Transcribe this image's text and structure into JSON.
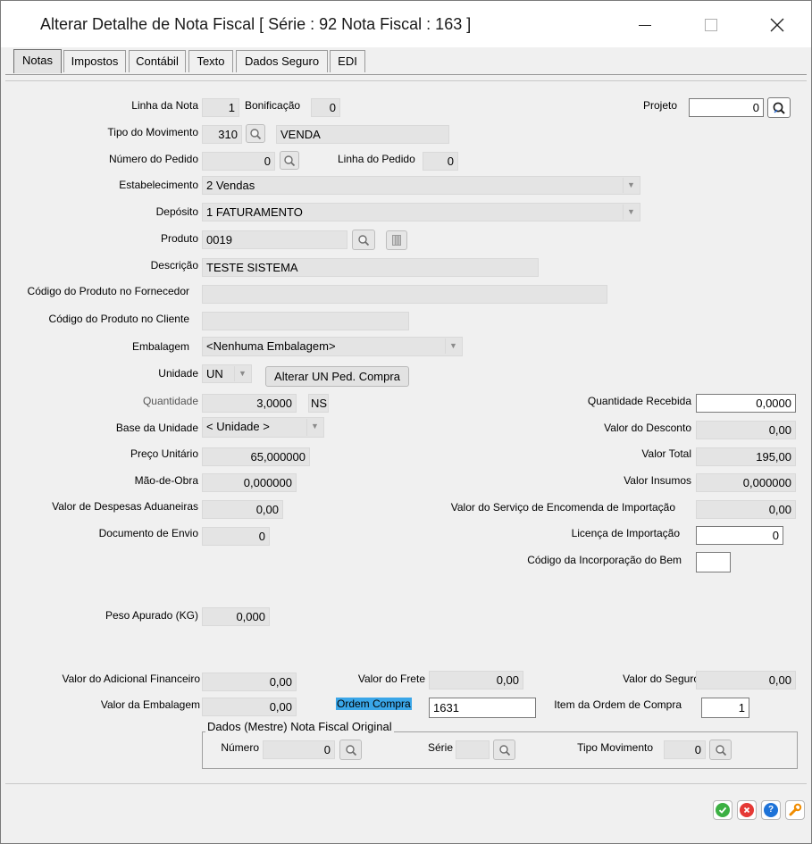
{
  "window": {
    "title": "Alterar Detalhe de Nota Fiscal [ Série : 92 Nota Fiscal : 163 ]"
  },
  "tabs": [
    {
      "label": "Notas",
      "active": true
    },
    {
      "label": "Impostos"
    },
    {
      "label": "Contábil"
    },
    {
      "label": "Texto"
    },
    {
      "label": "Dados Seguro"
    },
    {
      "label": "EDI"
    }
  ],
  "form": {
    "linha_da_nota": {
      "label": "Linha da Nota",
      "value": "1"
    },
    "bonificacao": {
      "label": "Bonificação",
      "value": "0"
    },
    "projeto": {
      "label": "Projeto",
      "value": "0"
    },
    "tipo_movimento": {
      "label": "Tipo do Movimento",
      "code": "310",
      "desc": "VENDA"
    },
    "numero_pedido": {
      "label": "Número do Pedido",
      "value": "0"
    },
    "linha_pedido": {
      "label": "Linha do Pedido",
      "value": "0"
    },
    "estabelecimento": {
      "label": "Estabelecimento",
      "value": "2 Vendas"
    },
    "deposito": {
      "label": "Depósito",
      "value": "1 FATURAMENTO"
    },
    "produto": {
      "label": "Produto",
      "value": "0019"
    },
    "descricao": {
      "label": "Descrição",
      "value": "TESTE SISTEMA"
    },
    "cod_prod_fornecedor": {
      "label": "Código do Produto no Fornecedor",
      "value": ""
    },
    "cod_prod_cliente": {
      "label": "Código do Produto no Cliente",
      "value": ""
    },
    "embalagem": {
      "label": "Embalagem",
      "value": "<Nenhuma Embalagem>"
    },
    "unidade": {
      "label": "Unidade",
      "value": "UN"
    },
    "alterar_un_btn": "Alterar UN Ped. Compra",
    "quantidade": {
      "label": "Quantidade",
      "value": "3,0000",
      "suffix": "NS"
    },
    "quantidade_recebida": {
      "label": "Quantidade Recebida",
      "value": "0,0000"
    },
    "base_unidade": {
      "label": "Base da Unidade",
      "value": "< Unidade >"
    },
    "valor_desconto": {
      "label": "Valor do Desconto",
      "value": "0,00"
    },
    "preco_unitario": {
      "label": "Preço Unitário",
      "value": "65,000000"
    },
    "valor_total": {
      "label": "Valor Total",
      "value": "195,00"
    },
    "mao_de_obra": {
      "label": "Mão-de-Obra",
      "value": "0,000000"
    },
    "valor_insumos": {
      "label": "Valor Insumos",
      "value": "0,000000"
    },
    "despesas_aduaneiras": {
      "label": "Valor de Despesas Aduaneiras",
      "value": "0,00"
    },
    "servico_encomenda": {
      "label": "Valor do Serviço de Encomenda de Importação",
      "value": "0,00"
    },
    "documento_envio": {
      "label": "Documento de Envio",
      "value": "0"
    },
    "licenca_importacao": {
      "label": "Licença de Importação",
      "value": "0"
    },
    "codigo_incorporacao": {
      "label": "Código da Incorporação do Bem",
      "value": ""
    },
    "peso_apurado": {
      "label": "Peso Apurado (KG)",
      "value": "0,000"
    },
    "adicional_financeiro": {
      "label": "Valor do Adicional Financeiro",
      "value": "0,00"
    },
    "valor_frete": {
      "label": "Valor do Frete",
      "value": "0,00"
    },
    "valor_seguro": {
      "label": "Valor do Seguro",
      "value": "0,00"
    },
    "valor_embalagem": {
      "label": "Valor da Embalagem",
      "value": "0,00"
    },
    "ordem_compra": {
      "label": "Ordem Compra",
      "value": "1631"
    },
    "item_ordem_compra": {
      "label": "Item da Ordem de Compra",
      "value": "1"
    }
  },
  "nf_original": {
    "title": "Dados (Mestre) Nota Fiscal Original",
    "numero": {
      "label": "Número",
      "value": "0"
    },
    "serie": {
      "label": "Série",
      "value": ""
    },
    "tipo_movimento": {
      "label": "Tipo Movimento",
      "value": "0"
    }
  },
  "colors": {
    "highlight": "#3aa6e8",
    "ok": "#3cb043",
    "cancel": "#e53935",
    "help": "#1e73d8",
    "tools": "#f08c00"
  }
}
